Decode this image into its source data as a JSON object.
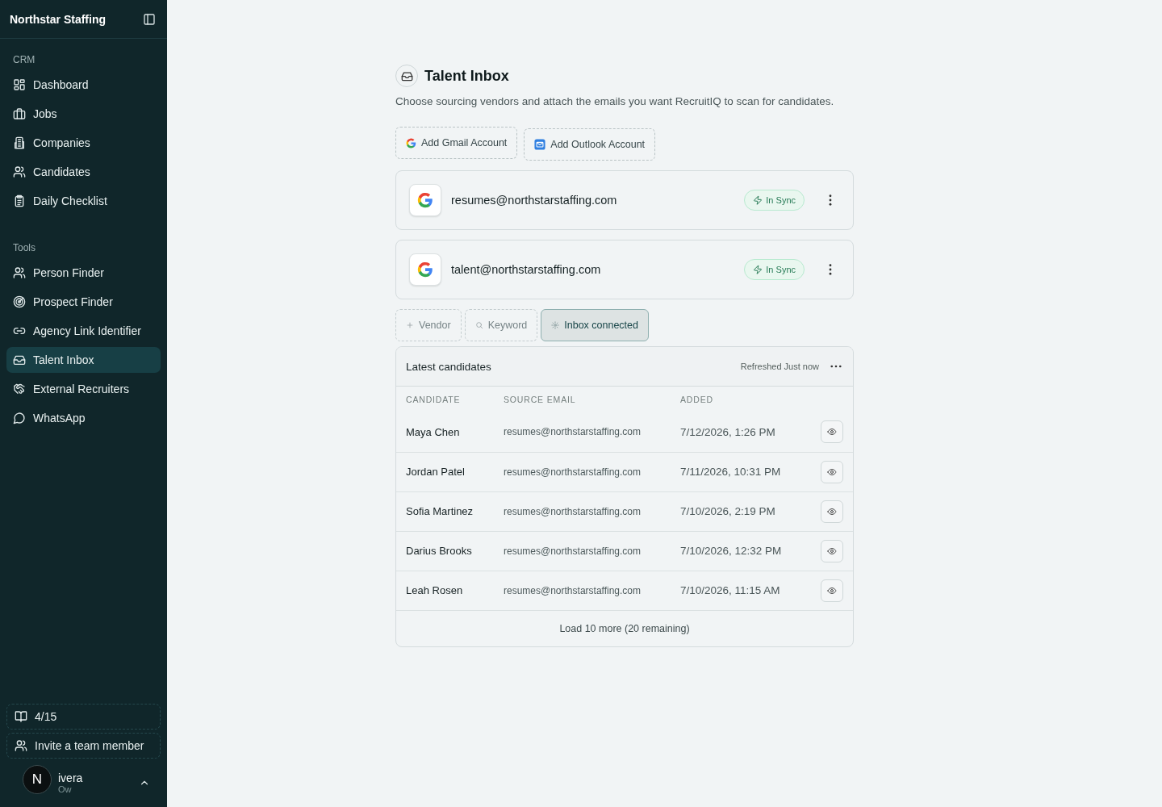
{
  "sidebar": {
    "brand": "Northstar Staffing",
    "sections": [
      {
        "title": "CRM",
        "items": [
          {
            "label": "Dashboard",
            "selected": false
          },
          {
            "label": "Jobs",
            "selected": false
          },
          {
            "label": "Companies",
            "selected": false
          },
          {
            "label": "Candidates",
            "selected": false
          },
          {
            "label": "Daily Checklist",
            "selected": false
          }
        ]
      },
      {
        "title": "Tools",
        "items": [
          {
            "label": "Person Finder",
            "selected": false
          },
          {
            "label": "Prospect Finder",
            "selected": false
          },
          {
            "label": "Agency Link Identifier",
            "selected": false
          },
          {
            "label": "Talent Inbox",
            "selected": true
          },
          {
            "label": "External Recruiters",
            "selected": false
          },
          {
            "label": "WhatsApp",
            "selected": false
          }
        ]
      }
    ],
    "footer": {
      "guide": "4/15",
      "invite": "Invite a team member",
      "user_name": "ivera",
      "user_role": "Ow",
      "badge": "N"
    }
  },
  "page": {
    "title": "Talent Inbox",
    "subtitle": "Choose sourcing vendors and attach the emails you want RecruitIQ to scan for candidates.",
    "add_buttons": [
      {
        "label": "Add Gmail Account",
        "kind": "gmail"
      },
      {
        "label": "Add Outlook Account",
        "kind": "outlook"
      }
    ],
    "accounts": [
      {
        "email": "resumes@northstarstaffing.com",
        "status": "In Sync"
      },
      {
        "email": "talent@northstarstaffing.com",
        "status": "In Sync"
      }
    ],
    "filters": [
      {
        "label": "Vendor",
        "kind": "vendor",
        "selected": false
      },
      {
        "label": "Keyword",
        "kind": "keyword",
        "selected": false
      },
      {
        "label": "Inbox connected",
        "kind": "inbox",
        "selected": true
      }
    ],
    "candidates": {
      "title": "Latest candidates",
      "refreshed": "Refreshed Just now",
      "columns": [
        "CANDIDATE",
        "SOURCE EMAIL",
        "ADDED"
      ],
      "rows": [
        {
          "name": "Maya Chen",
          "email": "resumes@northstarstaffing.com",
          "added": "7/12/2026, 1:26 PM"
        },
        {
          "name": "Jordan Patel",
          "email": "resumes@northstarstaffing.com",
          "added": "7/11/2026, 10:31 PM"
        },
        {
          "name": "Sofia Martinez",
          "email": "resumes@northstarstaffing.com",
          "added": "7/10/2026, 2:19 PM"
        },
        {
          "name": "Darius Brooks",
          "email": "resumes@northstarstaffing.com",
          "added": "7/10/2026, 12:32 PM"
        },
        {
          "name": "Leah Rosen",
          "email": "resumes@northstarstaffing.com",
          "added": "7/10/2026, 11:15 AM"
        }
      ],
      "load_more": "Load 10 more (20 remaining)"
    }
  }
}
